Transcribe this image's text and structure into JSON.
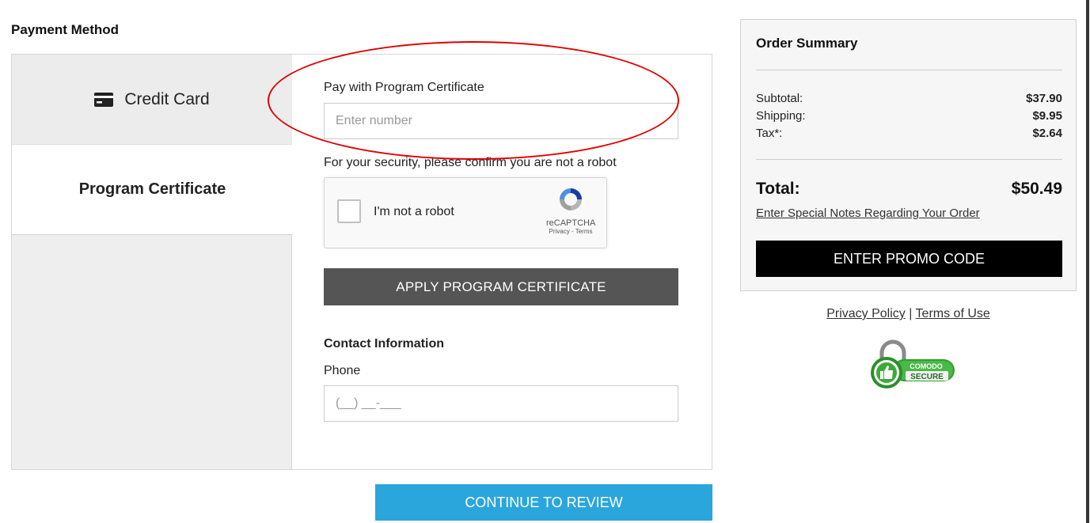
{
  "payment": {
    "heading": "Payment Method",
    "tabs": [
      {
        "label": "Credit Card",
        "icon": "credit-card-icon"
      },
      {
        "label": "Program Certificate"
      }
    ],
    "certificate": {
      "label": "Pay with Program Certificate",
      "placeholder": "Enter number"
    },
    "security_text": "For your security, please confirm you are not a robot",
    "captcha": {
      "checkbox_label": "I'm not a robot",
      "brand": "reCAPTCHA",
      "links": "Privacy - Terms"
    },
    "apply_button": "APPLY PROGRAM CERTIFICATE",
    "contact": {
      "heading": "Contact Information",
      "phone_label": "Phone",
      "phone_value": "(__) __-___"
    },
    "continue_button": "CONTINUE TO REVIEW"
  },
  "summary": {
    "title": "Order Summary",
    "subtotal_label": "Subtotal:",
    "subtotal": "$37.90",
    "shipping_label": "Shipping:",
    "shipping": "$9.95",
    "tax_label": "Tax*:",
    "tax": "$2.64",
    "total_label": "Total:",
    "total": "$50.49",
    "notes_link": "Enter Special Notes Regarding Your Order",
    "promo_button": "ENTER PROMO CODE"
  },
  "footer": {
    "privacy": "Privacy Policy",
    "separator": "|",
    "terms": "Terms of Use",
    "seal_top": "COMODO",
    "seal_bottom": "SECURE"
  },
  "colors": {
    "annotation": "#e00000",
    "continue": "#2ba6dc",
    "apply": "#555555",
    "promo": "#000000"
  }
}
